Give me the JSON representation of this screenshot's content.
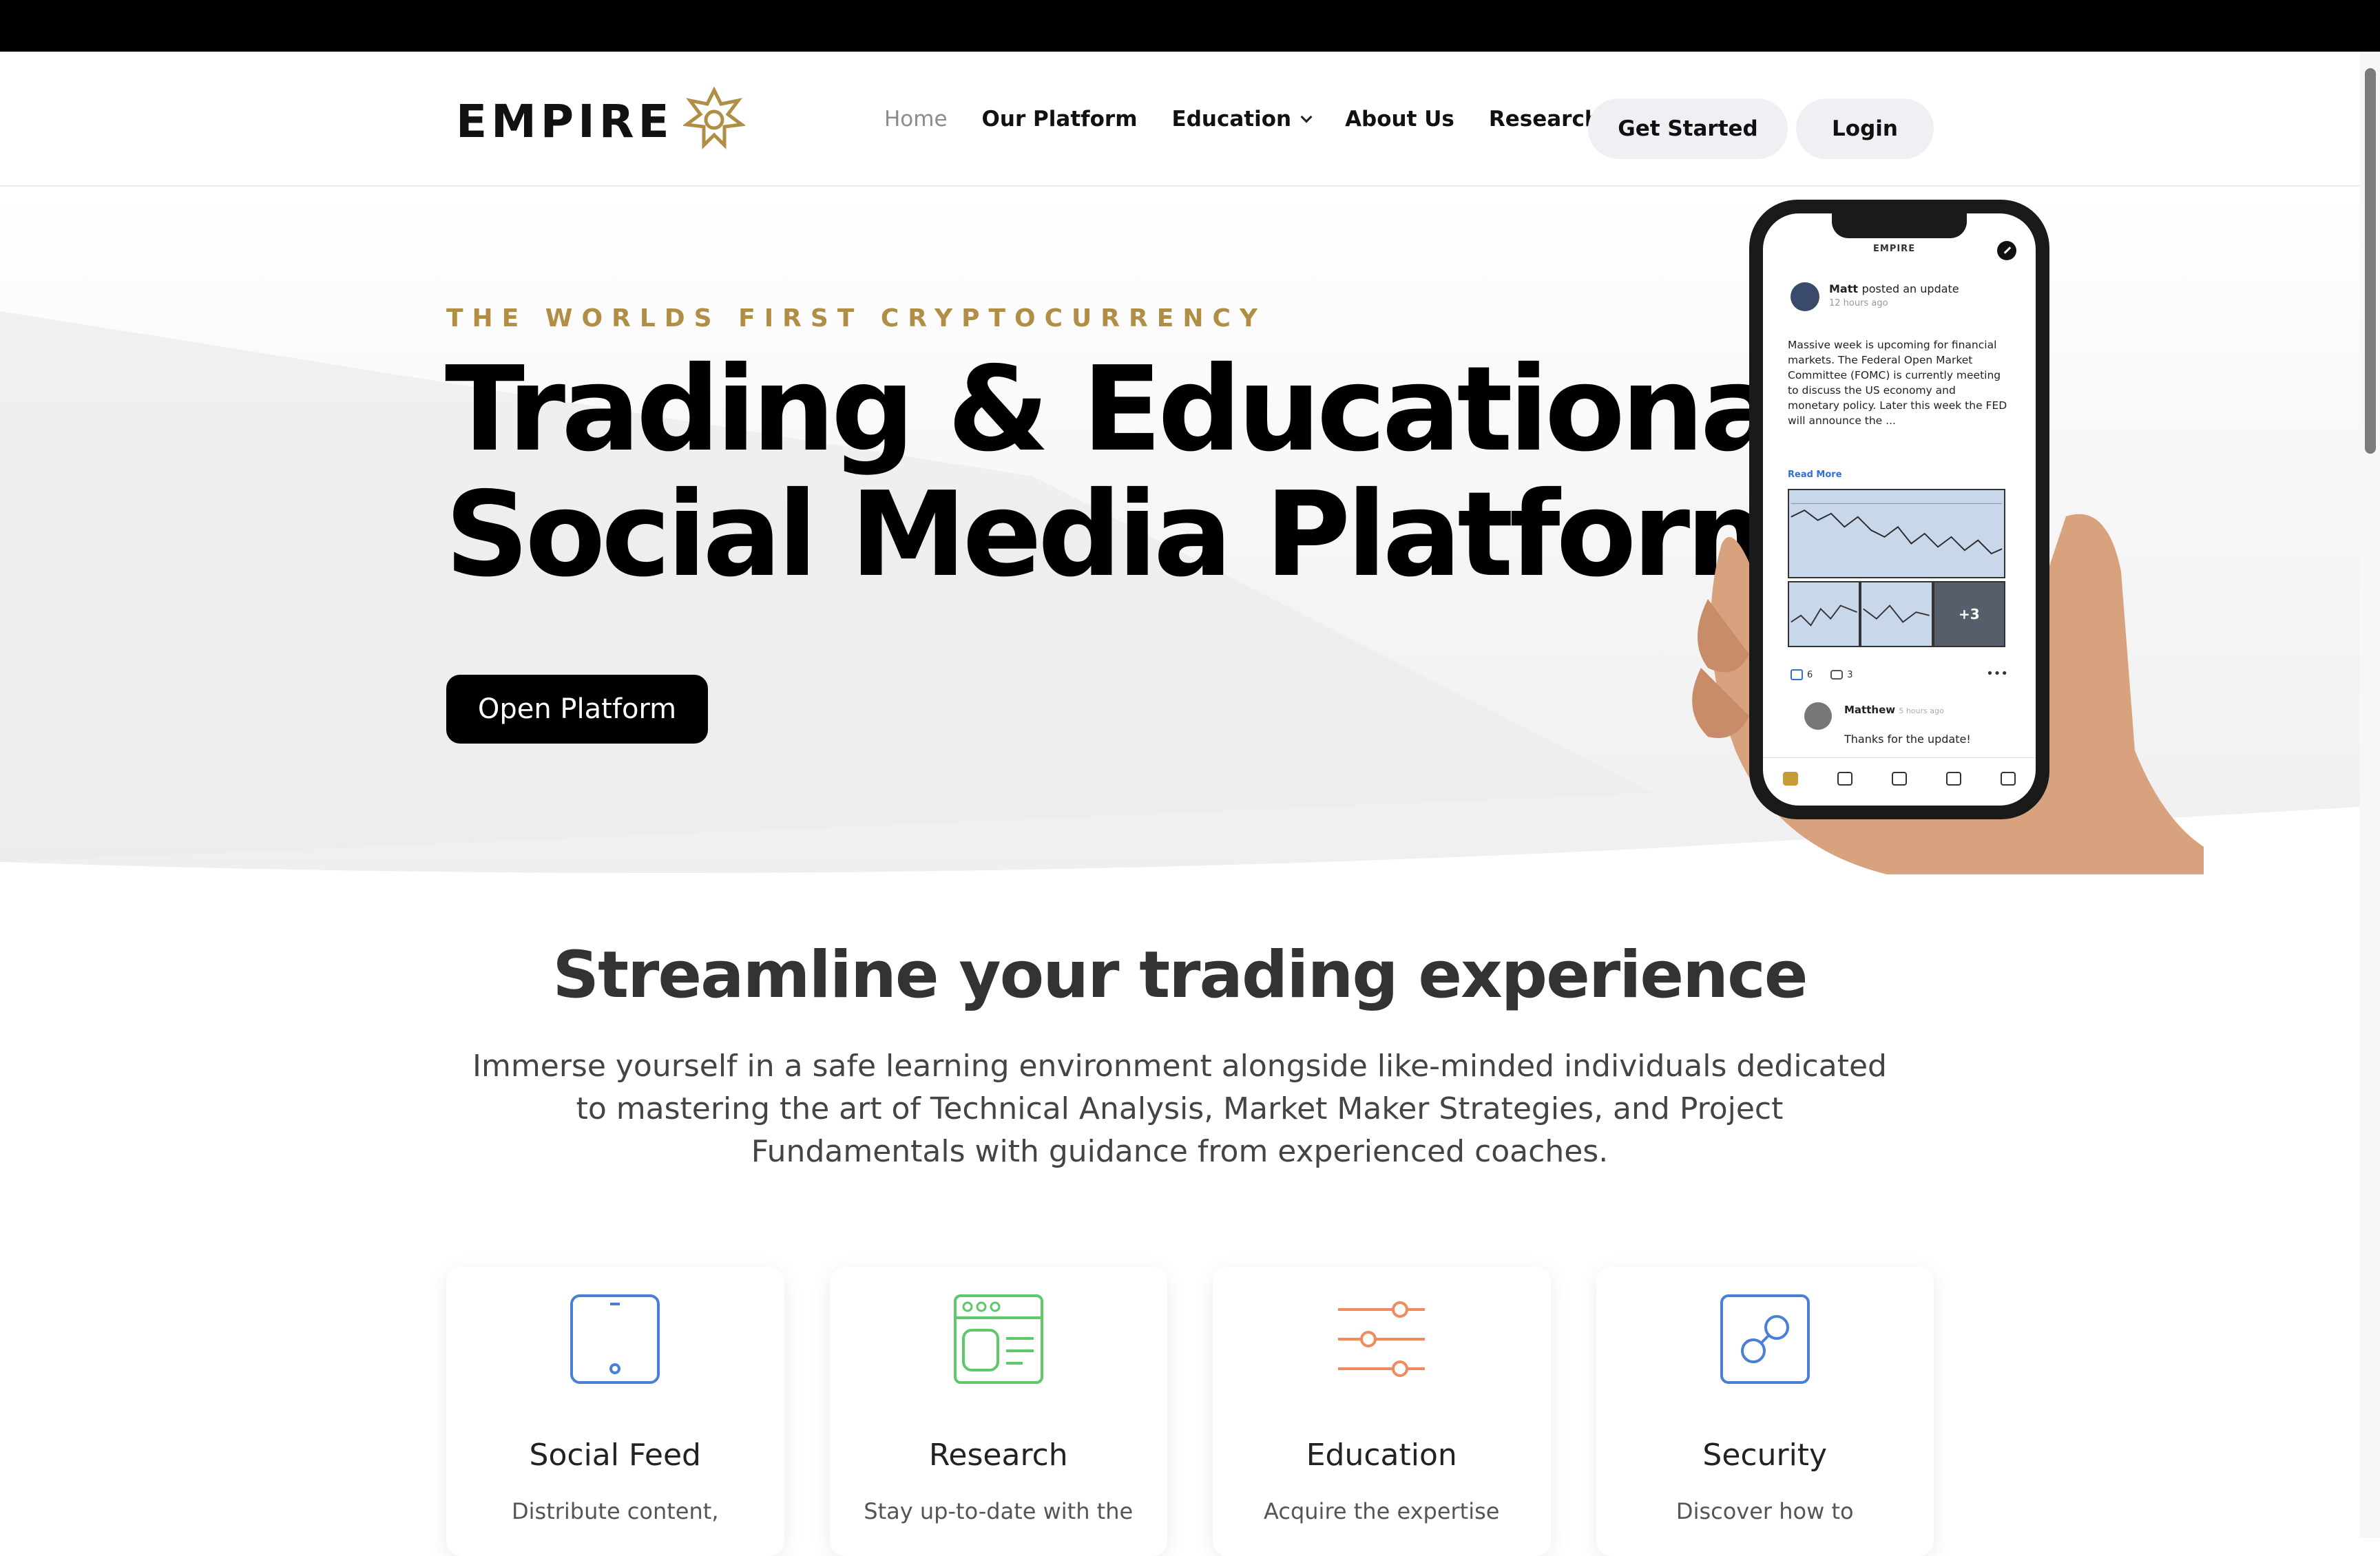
{
  "brand": {
    "name": "EMPIRE",
    "gold": "#b08e46"
  },
  "nav": {
    "items": [
      {
        "label": "Home",
        "active": true
      },
      {
        "label": "Our Platform"
      },
      {
        "label": "Education",
        "has_dropdown": true
      },
      {
        "label": "About Us"
      },
      {
        "label": "Research"
      }
    ],
    "get_started": "Get Started",
    "login": "Login"
  },
  "hero": {
    "eyebrow": "THE WORLDS FIRST CRYPTOCURRENCY",
    "headline_line1": "Trading & Educational",
    "headline_line2": "Social Media Platform",
    "cta": "Open Platform"
  },
  "phone": {
    "logo": "EMPIRE",
    "post_author": "Matt",
    "post_action": "posted an update",
    "post_time": "12 hours ago",
    "post_body": "Massive week is upcoming for financial markets. The Federal Open Market Committee (FOMC) is currently meeting to discuss the US economy and monetary policy. Later this week the FED will announce the ...",
    "read_more": "Read More",
    "more_images": "+3",
    "likes": "6",
    "comments": "3",
    "comment_author": "Matthew",
    "comment_time": "5 hours ago",
    "comment_text": "Thanks for the update!"
  },
  "section": {
    "title": "Streamline your trading experience",
    "subtitle": "Immerse yourself in a safe learning environment alongside like-minded individuals dedicated to mastering the art of Technical Analysis, Market Maker Strategies, and Project Fundamentals with guidance from experienced coaches."
  },
  "features": [
    {
      "title": "Social Feed",
      "desc": "Distribute content,",
      "icon": "tablet-icon",
      "color": "#4a7fd6"
    },
    {
      "title": "Research",
      "desc": "Stay up-to-date with the",
      "icon": "browser-window-icon",
      "color": "#5fc96a"
    },
    {
      "title": "Education",
      "desc": "Acquire the expertise",
      "icon": "sliders-icon",
      "color": "#f08b5e"
    },
    {
      "title": "Security",
      "desc": "Discover how to",
      "icon": "link-icon",
      "color": "#4a7fd6"
    }
  ]
}
